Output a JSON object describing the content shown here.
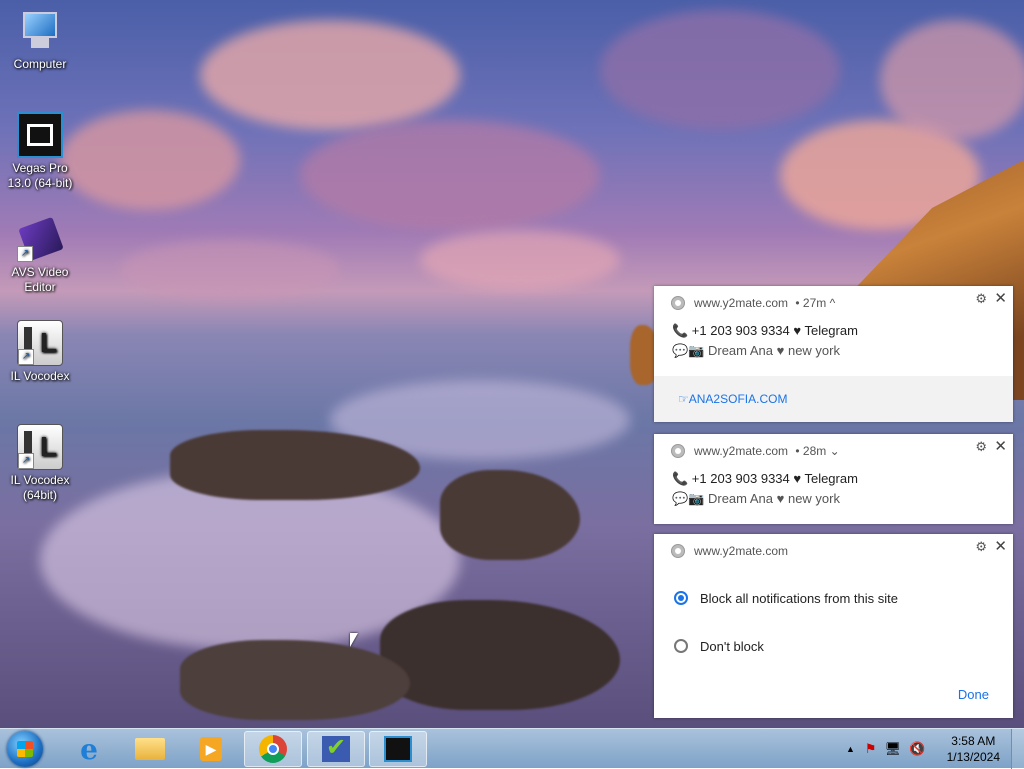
{
  "desktop": {
    "icons": [
      {
        "label": "Computer"
      },
      {
        "label": "Vegas Pro 13.0 (64-bit)"
      },
      {
        "label": "AVS Video Editor"
      },
      {
        "label": "IL Vocodex"
      },
      {
        "label": "IL Vocodex (64bit)"
      }
    ]
  },
  "notifications": [
    {
      "site": "www.y2mate.com",
      "time": "• 27m ^",
      "line1": "📞 +1 203 903 9334 ♥ Telegram",
      "line2": "💬📷 Dream Ana ♥ new york",
      "action": "☞ANA2SOFIA.COM"
    },
    {
      "site": "www.y2mate.com",
      "time": "• 28m ⌄",
      "line1": "📞 +1 203 903 9334 ♥ Telegram",
      "line2": "💬📷 Dream Ana ♥ new york"
    },
    {
      "site": "www.y2mate.com",
      "options": [
        {
          "label": "Block all notifications from this site",
          "selected": true
        },
        {
          "label": "Don't block",
          "selected": false
        }
      ],
      "done_label": "Done"
    }
  ],
  "taskbar": {
    "apps": [
      "start-button",
      "internet-explorer",
      "file-explorer",
      "media-player",
      "chrome",
      "task-app",
      "vegas-pro"
    ],
    "tray": {
      "overflow": "▲",
      "time": "3:58 AM",
      "date": "1/13/2024"
    }
  }
}
